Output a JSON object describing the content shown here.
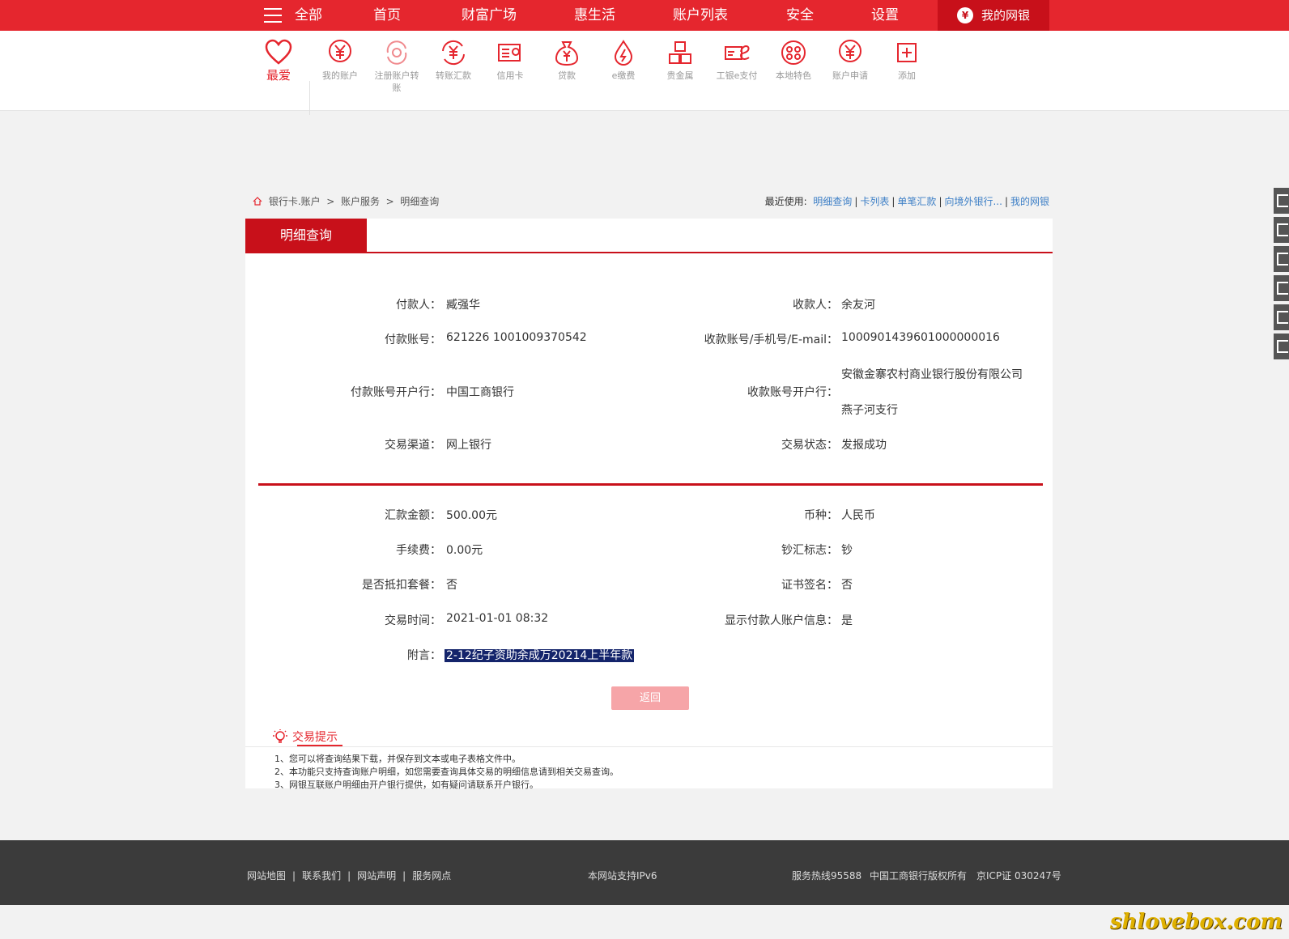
{
  "nav": {
    "all": "全部",
    "items": [
      "首页",
      "财富广场",
      "惠生活",
      "账户列表",
      "安全",
      "设置"
    ],
    "mybank": "我的网银"
  },
  "iconbar": {
    "favorite": "最爱",
    "items": [
      "我的账户",
      "注册账户转账",
      "转账汇款",
      "信用卡",
      "贷款",
      "e缴费",
      "贵金属",
      "工银e支付",
      "本地特色",
      "账户申请",
      "添加"
    ]
  },
  "breadcrumb": {
    "parts": [
      "银行卡.账户",
      "账户服务",
      "明细查询"
    ]
  },
  "recent": {
    "label": "最近使用:",
    "links": [
      "明细查询",
      "卡列表",
      "单笔汇款",
      "向境外银行...",
      "我的网银"
    ]
  },
  "tab": "明细查询",
  "details": {
    "payer_label": "付款人：",
    "payer": "臧强华",
    "payee_label": "收款人：",
    "payee": "余友河",
    "payer_acct_label": "付款账号：",
    "payer_acct": "621226 1001009370542",
    "payee_acct_label": "收款账号/手机号/E-mail：",
    "payee_acct": "1000901439601000000016",
    "payer_bank_label": "付款账号开户行：",
    "payer_bank": "中国工商银行",
    "payee_bank_label": "收款账号开户行：",
    "payee_bank_1": "安徽金寨农村商业银行股份有限公司",
    "payee_bank_2": "燕子河支行",
    "channel_label": "交易渠道：",
    "channel": "网上银行",
    "status_label": "交易状态：",
    "status": "发报成功",
    "amount_label": "汇款金额：",
    "amount": "500.00元",
    "currency_label": "币种：",
    "currency": "人民币",
    "fee_label": "手续费：",
    "fee": "0.00元",
    "cash_label": "钞汇标志：",
    "cash": "钞",
    "package_label": "是否抵扣套餐：",
    "package": "否",
    "cert_label": "证书签名：",
    "cert": "否",
    "time_label": "交易时间：",
    "time": "2021-01-01 08:32",
    "show_payer_label": "显示付款人账户信息：",
    "show_payer": "是",
    "memo_label": "附言：",
    "memo": "2-12纪子资助余成万20214上半年款"
  },
  "back_button": "返回",
  "tips": {
    "title": "交易提示",
    "items": [
      "1、您可以将查询结果下载，并保存到文本或电子表格文件中。",
      "2、本功能只支持查询账户明细，如您需要查询具体交易的明细信息请到相关交易查询。",
      "3、网银互联账户明细由开户银行提供，如有疑问请联系开户银行。"
    ]
  },
  "footer": {
    "links": [
      "网站地图",
      "联系我们",
      "网站声明",
      "服务网点"
    ],
    "ipv6": "本网站支持IPv6",
    "hotline": "服务热线95588",
    "copyright": "中国工商银行版权所有",
    "icp": "京ICP证 030247号"
  },
  "watermark": "shlovebox.com",
  "colors": {
    "brand": "#e5262e",
    "dark_red": "#c8101a",
    "link": "#3d7fc6"
  }
}
